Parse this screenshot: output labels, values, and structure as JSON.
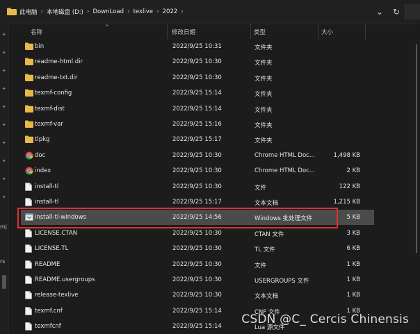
{
  "address": {
    "crumbs": [
      "此电脑",
      "本地磁盘 (D:)",
      "DownLoad",
      "texlive",
      "2022"
    ],
    "separator": "›",
    "chevron": "⌄",
    "refresh": "↻"
  },
  "sidebar_fragments": [
    "mj",
    "rs"
  ],
  "columns": {
    "name": "名称",
    "modified": "修改日期",
    "type": "类型",
    "size": "大小",
    "sort_caret": "^"
  },
  "files": [
    {
      "name": "bin",
      "modified": "2022/9/25 10:31",
      "type": "文件夹",
      "size": "",
      "icon": "folder-icon"
    },
    {
      "name": "readme-html.dir",
      "modified": "2022/9/25 10:30",
      "type": "文件夹",
      "size": "",
      "icon": "folder-icon"
    },
    {
      "name": "readme-txt.dir",
      "modified": "2022/9/25 10:30",
      "type": "文件夹",
      "size": "",
      "icon": "folder-icon"
    },
    {
      "name": "texmf-config",
      "modified": "2022/9/25 15:14",
      "type": "文件夹",
      "size": "",
      "icon": "folder-icon"
    },
    {
      "name": "texmf-dist",
      "modified": "2022/9/25 15:14",
      "type": "文件夹",
      "size": "",
      "icon": "folder-icon"
    },
    {
      "name": "texmf-var",
      "modified": "2022/9/25 15:16",
      "type": "文件夹",
      "size": "",
      "icon": "folder-icon"
    },
    {
      "name": "tlpkg",
      "modified": "2022/9/25 15:17",
      "type": "文件夹",
      "size": "",
      "icon": "folder-icon"
    },
    {
      "name": "doc",
      "modified": "2022/9/25 10:30",
      "type": "Chrome HTML Doc...",
      "size": "1,498 KB",
      "icon": "chrome-icon"
    },
    {
      "name": "index",
      "modified": "2022/9/25 10:30",
      "type": "Chrome HTML Doc...",
      "size": "2 KB",
      "icon": "chrome-icon"
    },
    {
      "name": "install-tl",
      "modified": "2022/9/25 10:30",
      "type": "文件",
      "size": "122 KB",
      "icon": "file-icon"
    },
    {
      "name": "install-tl",
      "modified": "2022/9/25 15:17",
      "type": "文本文档",
      "size": "1,215 KB",
      "icon": "file-icon"
    },
    {
      "name": "install-tl-windows",
      "modified": "2022/9/25 14:56",
      "type": "Windows 批处理文件",
      "size": "5 KB",
      "icon": "batch-file-icon",
      "selected": true
    },
    {
      "name": "LICENSE.CTAN",
      "modified": "2022/9/25 10:30",
      "type": "CTAN 文件",
      "size": "3 KB",
      "icon": "file-icon"
    },
    {
      "name": "LICENSE.TL",
      "modified": "2022/9/25 10:30",
      "type": "TL 文件",
      "size": "6 KB",
      "icon": "file-icon"
    },
    {
      "name": "README",
      "modified": "2022/9/25 10:30",
      "type": "文件",
      "size": "1 KB",
      "icon": "file-icon"
    },
    {
      "name": "README.usergroups",
      "modified": "2022/9/25 10:30",
      "type": "USERGROUPS 文件",
      "size": "1 KB",
      "icon": "file-icon"
    },
    {
      "name": "release-texlive",
      "modified": "2022/9/25 10:30",
      "type": "文本文档",
      "size": "1 KB",
      "icon": "file-icon"
    },
    {
      "name": "texmf.cnf",
      "modified": "2022/9/25 15:14",
      "type": "CNF 文件",
      "size": "1 KB",
      "icon": "file-icon"
    },
    {
      "name": "texmfcnf",
      "modified": "2022/9/25 15:14",
      "type": "Lua 源文件",
      "size": "",
      "icon": "file-icon"
    }
  ],
  "watermark": "CSDN @C_ Cercis Chinensis",
  "colors": {
    "folder": "#e8b84a",
    "selection": "#4b4b4b",
    "highlight_border": "#e0302f"
  }
}
